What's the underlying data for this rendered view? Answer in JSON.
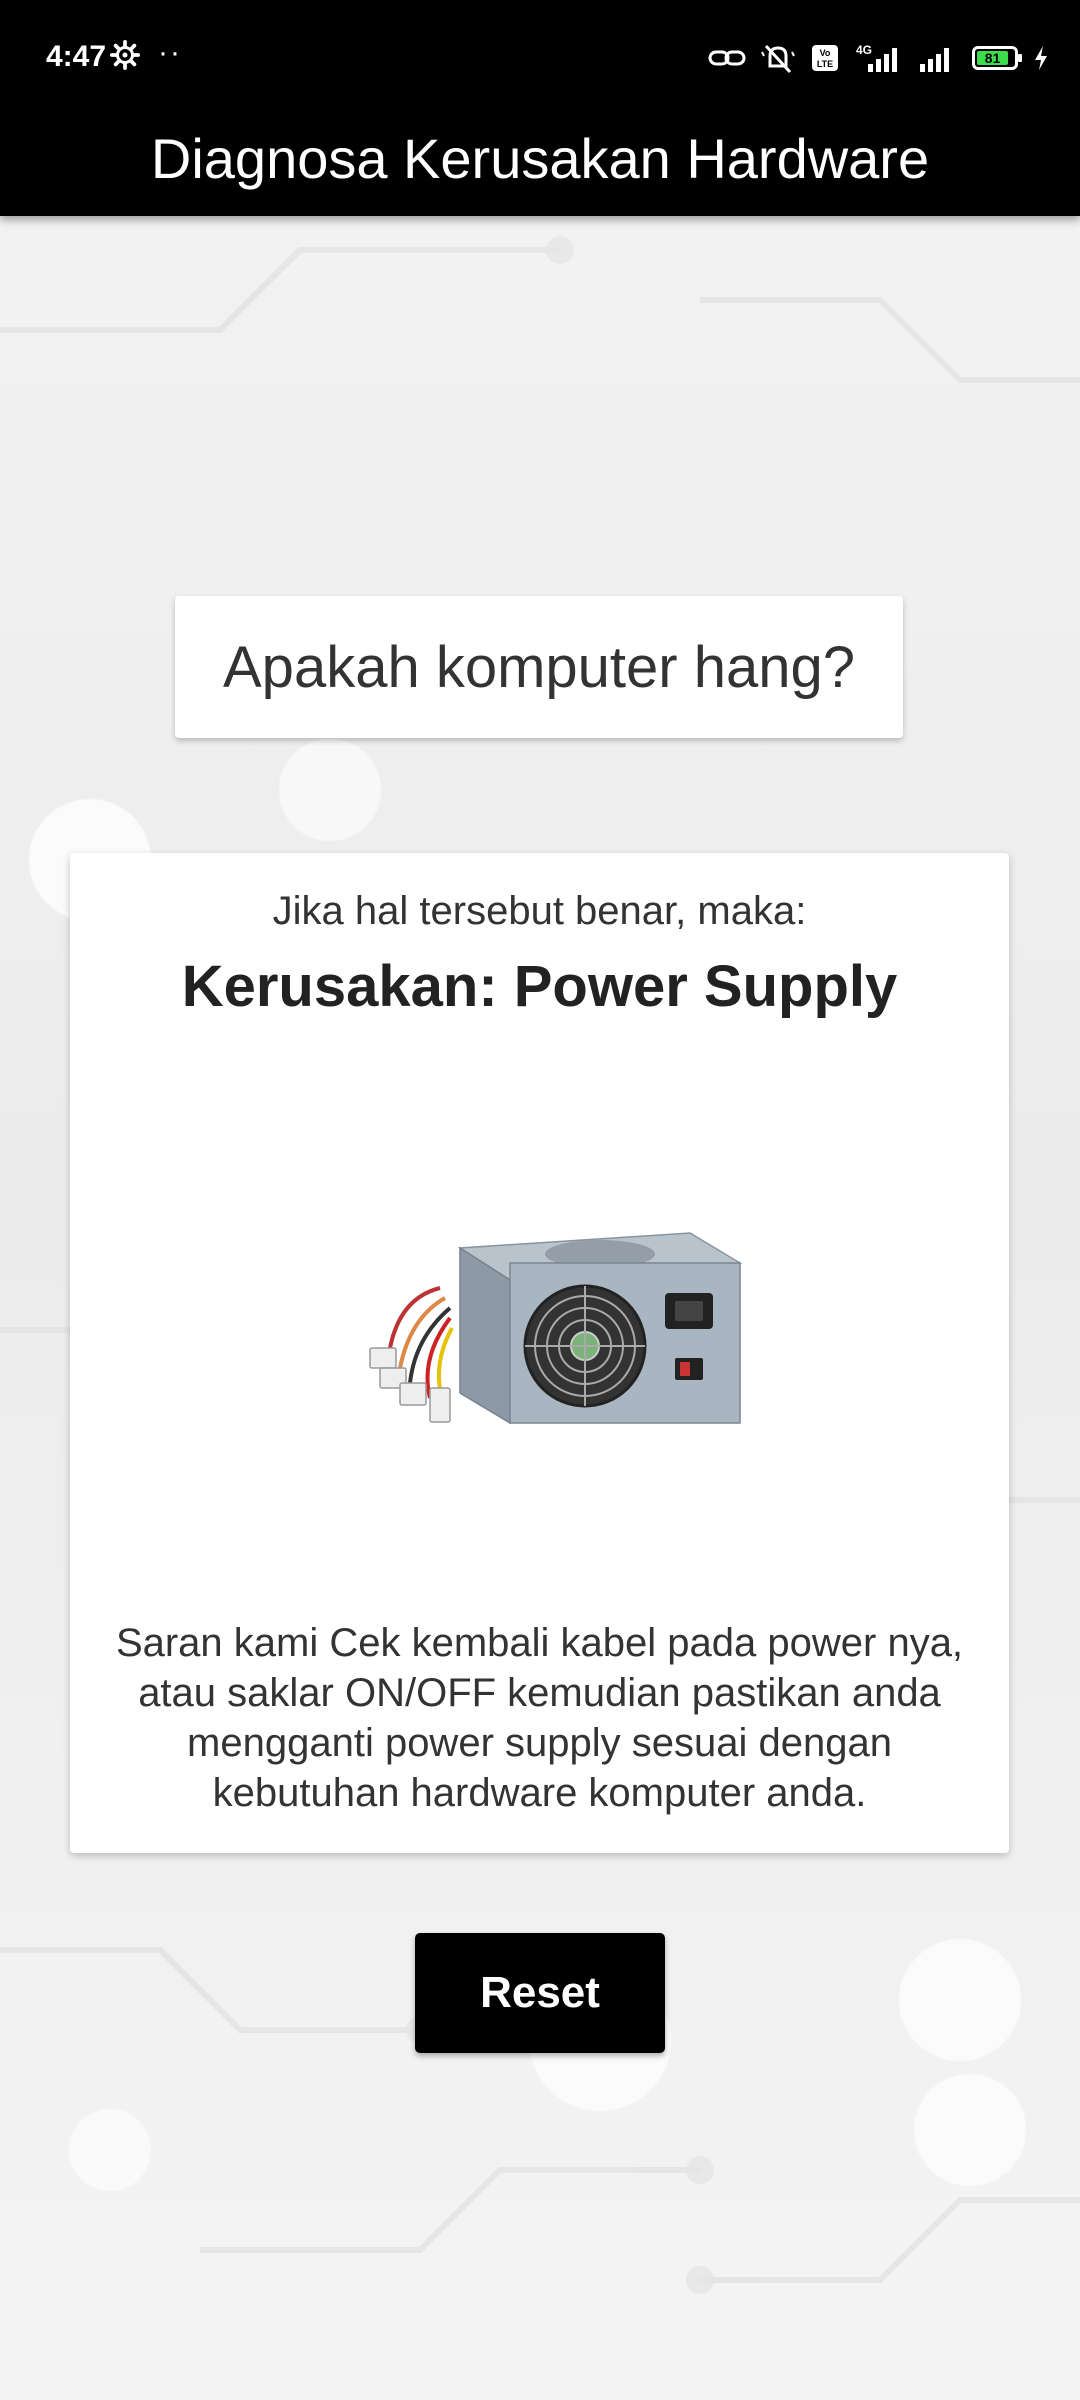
{
  "status_bar": {
    "time": "4:47",
    "dots": "··",
    "battery_level": "81",
    "network": "4G"
  },
  "app_bar": {
    "title": "Diagnosa Kerusakan Hardware"
  },
  "question": {
    "text": "Apakah komputer hang?"
  },
  "result": {
    "intro": "Jika hal tersebut benar, maka:",
    "title": "Kerusakan: Power Supply",
    "image_icon": "power-supply-image",
    "advice": "Saran kami Cek kembali kabel pada power nya, atau saklar ON/OFF kemudian pastikan anda mengganti power supply sesuai dengan kebutuhan hardware komputer anda."
  },
  "actions": {
    "reset_label": "Reset"
  }
}
